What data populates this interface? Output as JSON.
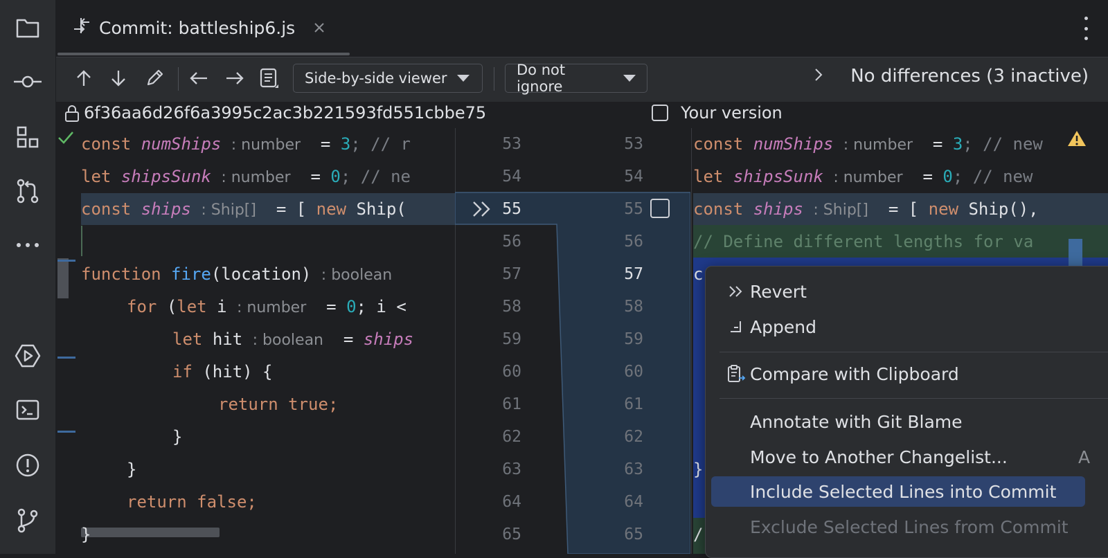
{
  "tab": {
    "title": "Commit: battleship6.js"
  },
  "toolbar": {
    "viewer_label": "Side-by-side viewer",
    "ignore_label": "Do not ignore",
    "status": "No differences (3 inactive)"
  },
  "header": {
    "revision_hash": "6f36aa6d26f6a3995c2ac3b221593fd551cbbe75",
    "your_version": "Your version"
  },
  "hints": {
    "number": ": number",
    "ship_array": ": Ship[]",
    "boolean": ": boolean"
  },
  "code": {
    "kw_const": "const",
    "kw_let": "let",
    "kw_new": "new",
    "kw_function": "function",
    "kw_for": "for",
    "kw_if": "if",
    "kw_return": "return",
    "kw_true": "true;",
    "kw_false": "false;",
    "v_numShips": "numShips",
    "v_shipsSunk": "shipsSunk",
    "v_ships": "ships",
    "n3": "3",
    "n0": "0",
    "fn_fire": "fire",
    "left_l53_tail": "; // r",
    "left_l54_tail": "; // ne",
    "left_l55_tail": "= [ ",
    "left_l55_end": "Ship(",
    "left_l57_tail": "(location)",
    "left_l58_open": "(",
    "left_l58_mid": "i",
    "left_l58_eq": "= ",
    "left_l58_end": "; i <",
    "left_l59_mid": "hit",
    "left_l59_eq": "= ",
    "left_l60_tail": "(hit) {",
    "brace_close": "}",
    "right_l53_tail": "; // new",
    "right_l54_tail": "; // new",
    "right_l55_tail": "= [ ",
    "right_l55_end": "Ship(),",
    "right_l56_cmt": "// Define different lengths for va",
    "right_l57_start": "c",
    "right_l63": "}",
    "right_l65": "/"
  },
  "line_numbers_left": [
    "53",
    "54",
    "55",
    "56",
    "57",
    "58",
    "59",
    "60",
    "61",
    "62",
    "63",
    "64",
    "65"
  ],
  "line_numbers_right": [
    "53",
    "54",
    "55",
    "56",
    "57",
    "58",
    "59",
    "60",
    "61",
    "62",
    "63",
    "64",
    "65"
  ],
  "context_menu": {
    "revert": "Revert",
    "append": "Append",
    "compare_clipboard": "Compare with Clipboard",
    "annotate": "Annotate with Git Blame",
    "move_changelist": "Move to Another Changelist...",
    "move_shortcut": "A",
    "include_lines": "Include Selected Lines into Commit",
    "exclude_lines": "Exclude Selected Lines from Commit"
  },
  "colors": {
    "selected_line": "#2e3b4a",
    "added_line": "#294436",
    "modified_block": "#1f3a8a",
    "menu_selected": "#2e436e"
  }
}
